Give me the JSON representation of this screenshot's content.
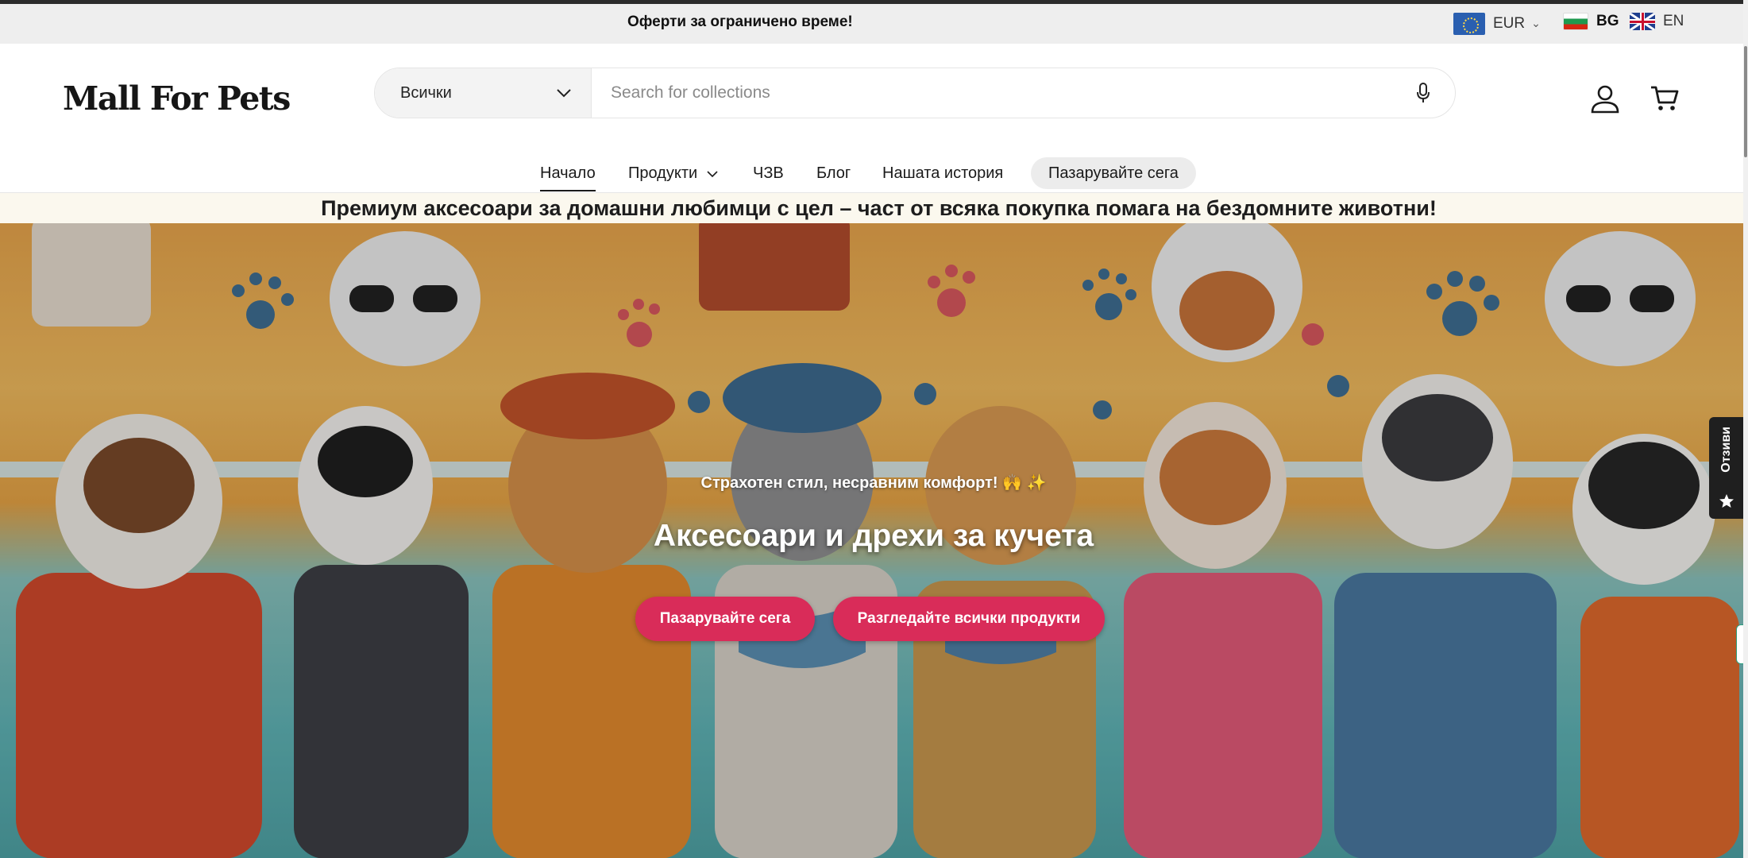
{
  "topbar": {
    "message": "Оферти за ограничено време!",
    "currency": "EUR",
    "languages": [
      "BG",
      "EN"
    ]
  },
  "header": {
    "logo": "Mall For Pets",
    "search": {
      "category": "Всички",
      "placeholder": "Search for collections"
    }
  },
  "nav": {
    "items": [
      {
        "label": "Начало"
      },
      {
        "label": "Продукти"
      },
      {
        "label": "ЧЗВ"
      },
      {
        "label": "Блог"
      },
      {
        "label": "Нашата история"
      },
      {
        "label": "Пазарувайте сега"
      }
    ]
  },
  "promo": {
    "text": "Премиум аксесоари за домашни любимци с цел – част от всяка покупка помага на бездомните животни!"
  },
  "hero": {
    "subtitle": "Страхотен стил, несравним комфорт! 🙌 ✨",
    "title": "Аксесоари и дрехи за кучета",
    "buttons": [
      "Пазарувайте сега",
      "Разгледайте всички продукти"
    ]
  },
  "reviews_tab": {
    "label": "Отзиви"
  },
  "colors": {
    "accent_button": "#d92c59",
    "topbar_bg": "#eeeeee",
    "promo_bg": "#fbf8ee"
  }
}
